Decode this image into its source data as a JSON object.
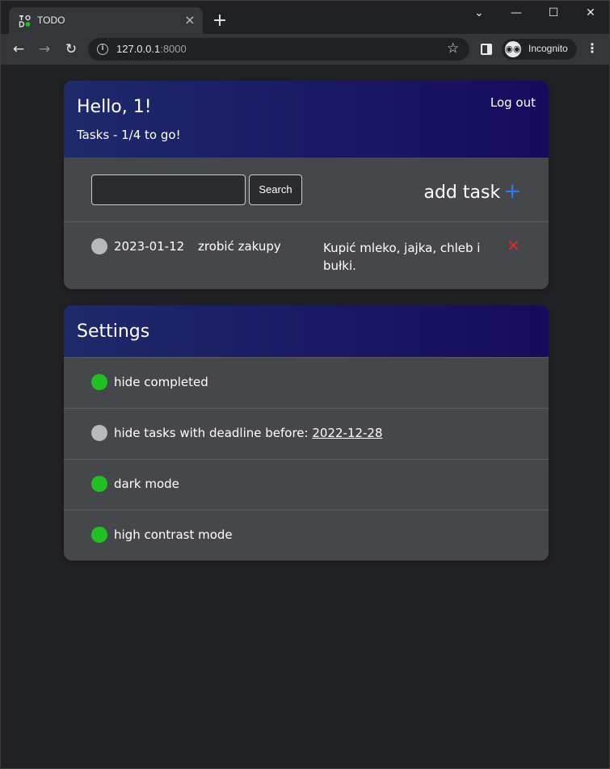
{
  "browser": {
    "tab_title": "TODO",
    "tab_close": "×",
    "new_tab": "+",
    "url_host": "127.0.0.1",
    "url_port": ":8000",
    "incognito_label": "Incognito"
  },
  "header": {
    "greeting": "Hello, 1!",
    "tasks_count": "Tasks - 1/4 to go!",
    "logout": "Log out"
  },
  "toolbar": {
    "search_value": "",
    "search_button": "Search",
    "add_task": "add task",
    "add_icon": "+"
  },
  "tasks": [
    {
      "done": false,
      "date": "2023-01-12",
      "title": "zrobić zakupy",
      "description": "Kupić mleko, jajka, chleb i bułki.",
      "delete_icon": "✕"
    }
  ],
  "settings": {
    "title": "Settings",
    "items": [
      {
        "label": "hide completed",
        "enabled": true
      },
      {
        "label": "hide tasks with deadline before: ",
        "date": "2022-12-28",
        "enabled": false
      },
      {
        "label": "dark mode",
        "enabled": true
      },
      {
        "label": "high contrast mode",
        "enabled": true
      }
    ]
  },
  "colors": {
    "toggle_on": "#23c025",
    "toggle_off": "#b8b9bb",
    "accent_plus": "#2b7bff",
    "delete": "#e8262b"
  }
}
